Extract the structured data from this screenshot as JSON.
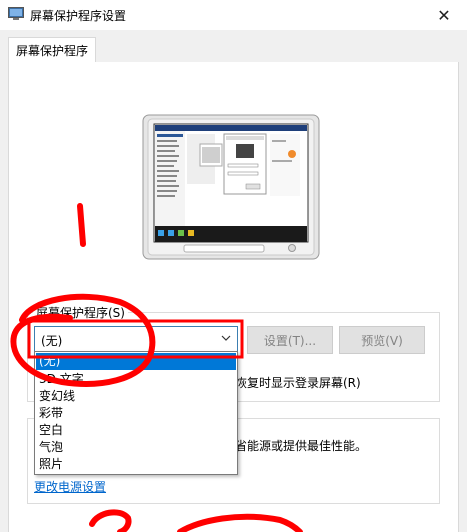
{
  "window": {
    "title": "屏幕保护程序设置",
    "close_glyph": "✕"
  },
  "tabs": [
    {
      "label": "屏幕保护程序"
    }
  ],
  "screensaver": {
    "group_label": "屏幕保护程序(S)",
    "selected": "(无)",
    "options": [
      "(无)",
      "3D 文字",
      "变幻线",
      "彩带",
      "空白",
      "气泡",
      "照片"
    ],
    "settings_button": "设置(T)...",
    "preview_button": "预览(V)",
    "resume_text": "恢复时显示登录屏幕(R)"
  },
  "power": {
    "description": "省能源或提供最佳性能。",
    "link": "更改电源设置"
  },
  "colors": {
    "accent": "#0078d7",
    "annotation": "#ff0000"
  }
}
